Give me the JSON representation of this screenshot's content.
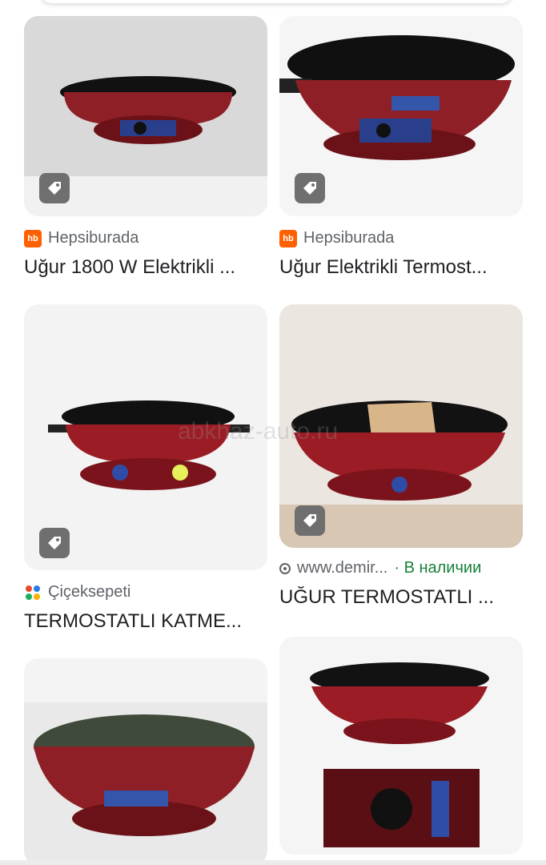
{
  "watermark": "abkhaz-auto.ru",
  "results": [
    {
      "source": "Hepsiburada",
      "source_icon": "hepsiburada-logo",
      "title": "Uğur 1800 W Elektrikli ...",
      "status": ""
    },
    {
      "source": "Hepsiburada",
      "source_icon": "hepsiburada-logo",
      "title": "Uğur Elektrikli Termost...",
      "status": ""
    },
    {
      "source": "Çiçeksepeti",
      "source_icon": "ciceksepeti-logo",
      "title": "TERMOSTATLI KATME...",
      "status": ""
    },
    {
      "source": "www.demir...",
      "source_icon": "website-icon",
      "title": "UĞUR TERMOSTATLI ...",
      "status": "· В наличии"
    },
    {
      "source": "",
      "title": "",
      "status": ""
    },
    {
      "source": "",
      "title": "",
      "status": ""
    }
  ],
  "colors": {
    "accent": "#188038",
    "product_red": "#8e1f26",
    "plate": "#151515"
  }
}
